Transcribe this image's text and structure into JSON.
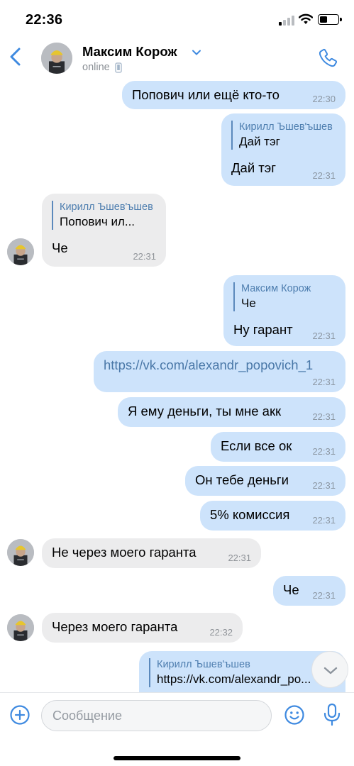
{
  "status_bar": {
    "time": "22:36"
  },
  "header": {
    "name": "Максим Корож",
    "status": "online",
    "icons": {
      "back": "chevron-left-icon",
      "call": "phone-icon",
      "device": "mobile-phone-icon"
    }
  },
  "messages": [
    {
      "dir": "out",
      "text": "Попович или ещё кто-то",
      "time": "22:30"
    },
    {
      "dir": "out",
      "reply_author": "Кирилл Ъшев'ъшев",
      "reply_text": "Дай тэг",
      "text": "Дай тэг",
      "time": "22:31"
    },
    {
      "dir": "in",
      "reply_author": "Кирилл Ъшев'ъшев",
      "reply_text": "Попович ил...",
      "text": "Че",
      "time": "22:31"
    },
    {
      "dir": "out",
      "reply_author": "Максим Корож",
      "reply_text": "Че",
      "text": "Ну гарант",
      "time": "22:31"
    },
    {
      "dir": "out",
      "text": "https://vk.com/alexandr_popovich_1",
      "time": "22:31"
    },
    {
      "dir": "out",
      "text": "Я ему деньги, ты мне акк",
      "time": "22:31"
    },
    {
      "dir": "out",
      "text": "Если все ок",
      "time": "22:31"
    },
    {
      "dir": "out",
      "text": "Он тебе деньги",
      "time": "22:31"
    },
    {
      "dir": "out",
      "text": "5% комиссия",
      "time": "22:31"
    },
    {
      "dir": "in",
      "text": "Не через моего гаранта",
      "time": "22:31"
    },
    {
      "dir": "out",
      "text": "Че",
      "time": "22:31"
    },
    {
      "dir": "in",
      "text": "Через моего гаранта",
      "time": "22:32"
    },
    {
      "dir": "out",
      "reply_author": "Кирилл Ъшев'ъшев",
      "reply_text": "https://vk.com/alexandr_po..."
    }
  ],
  "composer": {
    "placeholder": "Сообщение",
    "icons": {
      "attach": "plus-circle-icon",
      "emoji": "smiley-icon",
      "voice": "microphone-icon",
      "scroll": "chevron-down-icon"
    }
  },
  "colors": {
    "accent": "#3f8ae0",
    "outgoing_bubble": "#cde3fb",
    "incoming_bubble": "#ececed",
    "reply_author": "#4e7eaf",
    "link": "#4a78a8"
  }
}
